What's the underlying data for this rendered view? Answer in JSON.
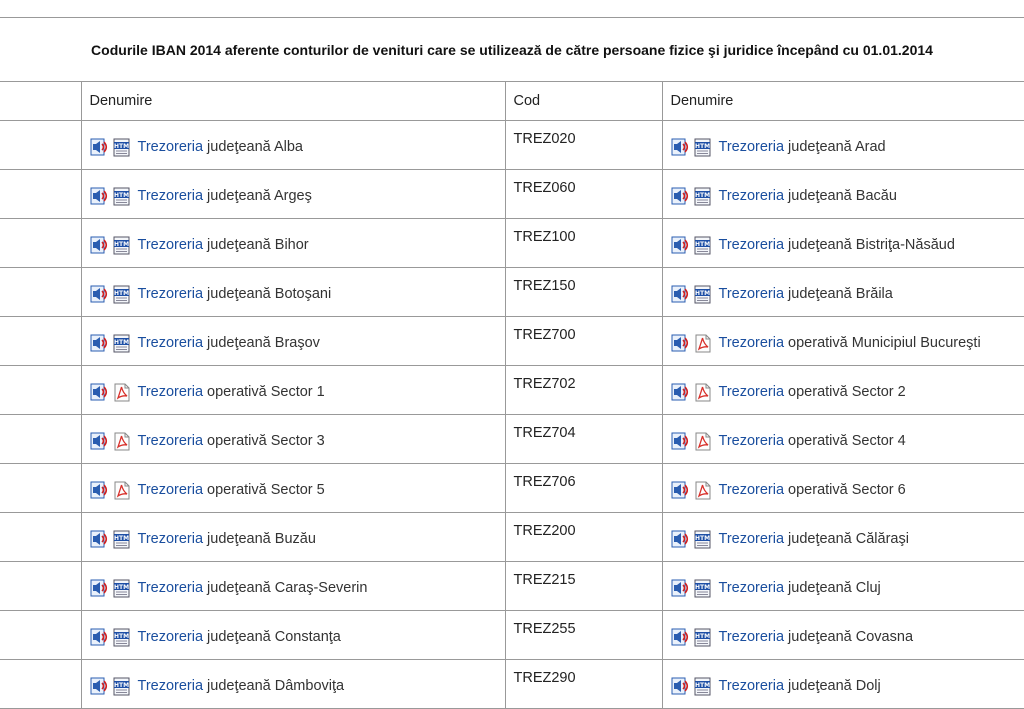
{
  "page": {
    "title": "Codurile IBAN 2014 aferente conturilor de venituri care se utilizează de către persoane fizice şi juridice începând cu 01.01.2014"
  },
  "table": {
    "headers": [
      "Denumire",
      "Cod",
      "Denumire"
    ],
    "rows": [
      {
        "left": {
          "icon": "htm",
          "link": "Trezoreria",
          "rest": "judeţeană Alba"
        },
        "code": "TREZ020",
        "right": {
          "icon": "htm",
          "link": "Trezoreria",
          "rest": "judeţeană Arad"
        }
      },
      {
        "left": {
          "icon": "htm",
          "link": "Trezoreria",
          "rest": "judeţeană Argeş"
        },
        "code": "TREZ060",
        "right": {
          "icon": "htm",
          "link": "Trezoreria",
          "rest": "judeţeană Bacău"
        }
      },
      {
        "left": {
          "icon": "htm",
          "link": "Trezoreria",
          "rest": "judeţeană Bihor"
        },
        "code": "TREZ100",
        "right": {
          "icon": "htm",
          "link": "Trezoreria",
          "rest": "judeţeană Bistriţa-Năsăud"
        }
      },
      {
        "left": {
          "icon": "htm",
          "link": "Trezoreria",
          "rest": "judeţeană Botoşani"
        },
        "code": "TREZ150",
        "right": {
          "icon": "htm",
          "link": "Trezoreria",
          "rest": "judeţeană Brăila"
        }
      },
      {
        "left": {
          "icon": "htm",
          "link": "Trezoreria",
          "rest": "judeţeană Braşov"
        },
        "code": "TREZ700",
        "right": {
          "icon": "pdf",
          "link": "Trezoreria",
          "rest": "operativă Municipiul Bucureşti"
        }
      },
      {
        "left": {
          "icon": "pdf",
          "link": "Trezoreria",
          "rest": "operativă Sector 1"
        },
        "code": "TREZ702",
        "right": {
          "icon": "pdf",
          "link": "Trezoreria",
          "rest": "operativă Sector 2"
        }
      },
      {
        "left": {
          "icon": "pdf",
          "link": "Trezoreria",
          "rest": "operativă Sector 3"
        },
        "code": "TREZ704",
        "right": {
          "icon": "pdf",
          "link": "Trezoreria",
          "rest": "operativă Sector 4"
        }
      },
      {
        "left": {
          "icon": "pdf",
          "link": "Trezoreria",
          "rest": "operativă Sector 5"
        },
        "code": "TREZ706",
        "right": {
          "icon": "pdf",
          "link": "Trezoreria",
          "rest": "operativă Sector 6"
        }
      },
      {
        "left": {
          "icon": "htm",
          "link": "Trezoreria",
          "rest": "judeţeană Buzău"
        },
        "code": "TREZ200",
        "right": {
          "icon": "htm",
          "link": "Trezoreria",
          "rest": "judeţeană Călăraşi"
        }
      },
      {
        "left": {
          "icon": "htm",
          "link": "Trezoreria",
          "rest": "judeţeană Caraş-Severin"
        },
        "code": "TREZ215",
        "right": {
          "icon": "htm",
          "link": "Trezoreria",
          "rest": "judeţeană Cluj"
        }
      },
      {
        "left": {
          "icon": "htm",
          "link": "Trezoreria",
          "rest": "judeţeană Constanţa"
        },
        "code": "TREZ255",
        "right": {
          "icon": "htm",
          "link": "Trezoreria",
          "rest": "judeţeană Covasna"
        }
      },
      {
        "left": {
          "icon": "htm",
          "link": "Trezoreria",
          "rest": "judeţeană Dâmboviţa"
        },
        "code": "TREZ290",
        "right": {
          "icon": "htm",
          "link": "Trezoreria",
          "rest": "judeţeană Dolj"
        }
      }
    ]
  },
  "icons": {
    "audio": "speaker-icon",
    "htm": "htm-file-icon",
    "pdf": "pdf-file-icon"
  },
  "colors": {
    "link": "#1a4e9e",
    "border": "#999999",
    "speaker_blue": "#2a5db0",
    "speaker_red": "#d22020",
    "pdf_red": "#d8302a"
  }
}
